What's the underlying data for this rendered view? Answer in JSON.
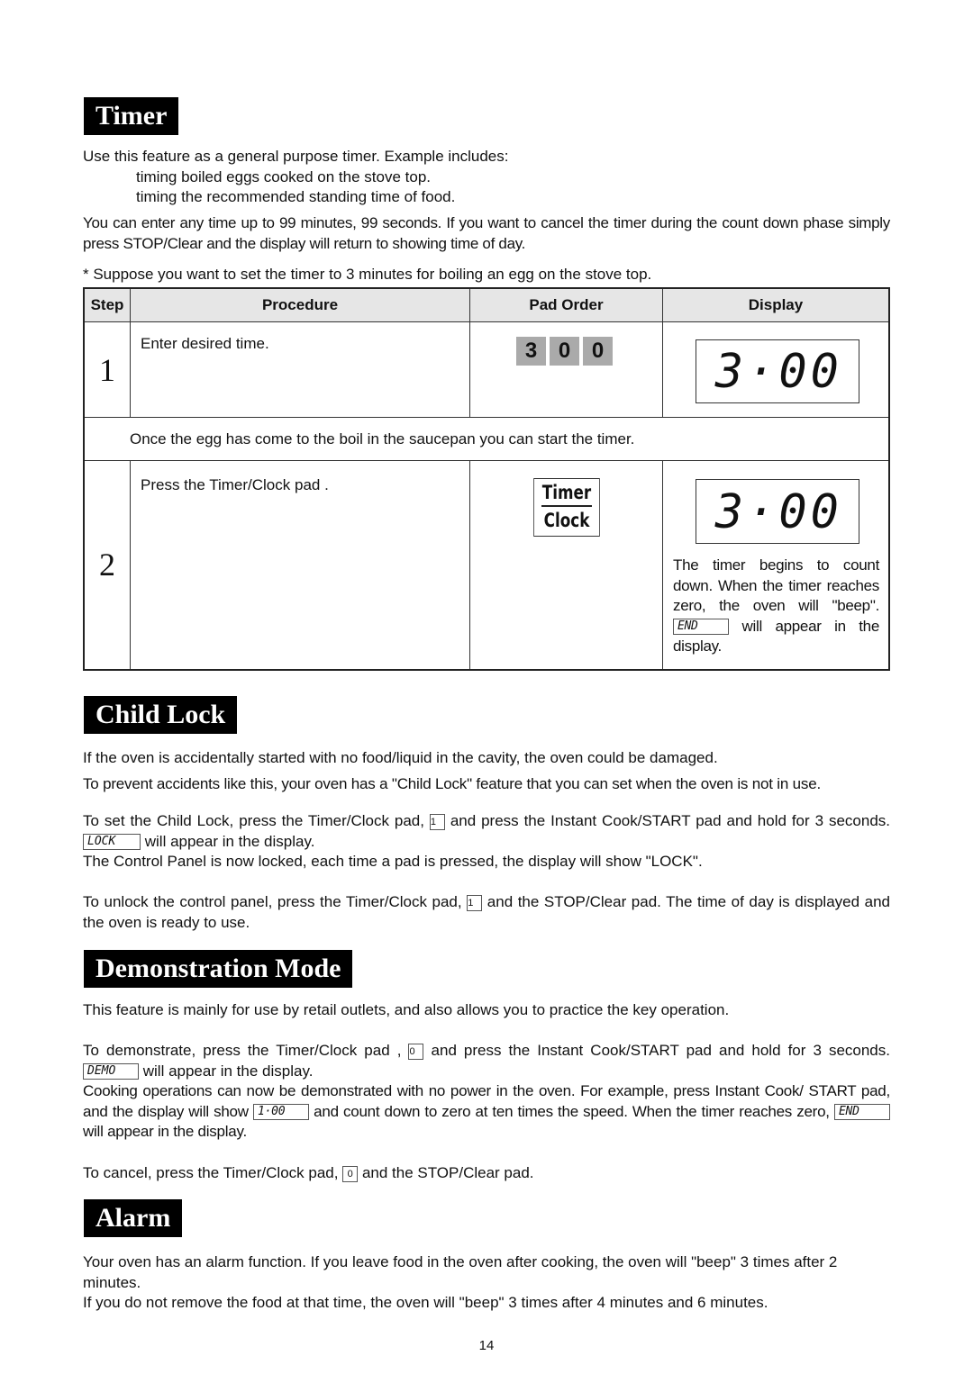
{
  "timer": {
    "heading": "Timer",
    "intro": "Use this feature as a general purpose timer. Example includes:",
    "examples": [
      "timing boiled eggs cooked on the stove top.",
      "timing the recommended standing time of food."
    ],
    "para2": "You can enter any time up to 99 minutes, 99 seconds. If you want to cancel the timer during the count down phase simply press STOP/Clear and the display will return to showing time of day.",
    "note": "* Suppose you want to set the timer to 3 minutes for boiling an egg on the stove top.",
    "table": {
      "headers": [
        "Step",
        "Procedure",
        "Pad Order",
        "Display"
      ],
      "step1": {
        "num": "1",
        "procedure": "Enter desired time.",
        "pads": [
          "3",
          "0",
          "0"
        ],
        "display": "3·00"
      },
      "between": "Once the egg has come to the boil in the saucepan you can start the timer.",
      "step2": {
        "num": "2",
        "procedure": "Press the Timer/Clock pad .",
        "pad_top": "Timer",
        "pad_bottom": "Clock",
        "display": "3·00",
        "desc_pre": "The timer begins to count down. When the timer reaches zero, the oven will \"beep\".",
        "end_label": "END",
        "desc_post": "will appear in the display."
      }
    }
  },
  "child_lock": {
    "heading": "Child Lock",
    "p1": "If the oven is accidentally started with no food/liquid in the cavity, the oven could be damaged.",
    "p2": "To prevent accidents like this, your oven has a \"Child Lock\" feature that you can set when the oven is not in use.",
    "p3a": "To set the Child Lock, press the Timer/Clock pad,",
    "key1": "1",
    "p3b": "and press the Instant Cook/START pad and hold for 3 seconds.",
    "lock_label": "LOCK",
    "p3c": "will appear in the display.",
    "p4": "The Control Panel is now locked, each time a pad is pressed, the display will show \"LOCK\".",
    "p5a": "To unlock the control panel, press the Timer/Clock pad,",
    "p5b": "and the STOP/Clear pad. The time of day is displayed and the oven is ready to use."
  },
  "demo": {
    "heading": "Demonstration Mode",
    "p1": "This feature is mainly for use by retail outlets, and also allows you to practice the key operation.",
    "p2a": "To demonstrate, press the Timer/Clock pad ,",
    "key0": "0",
    "p2b": "and press the Instant Cook/START pad and hold for 3 seconds.",
    "demo_label": "DEMO",
    "p2c": "will appear in the display.",
    "p3a": "Cooking operations can now be demonstrated with no power in the oven. For example, press Instant Cook/ START pad, and the display will show",
    "one_label": "1·00",
    "p3b": "and count down to zero at ten times the speed. When the timer reaches zero,",
    "end_label": "END",
    "p3c": "will appear in the display.",
    "p4a": "To cancel, press the Timer/Clock pad,",
    "p4b": "and the STOP/Clear pad."
  },
  "alarm": {
    "heading": "Alarm",
    "p1": "Your oven has an alarm function. If you leave food in the oven after cooking, the oven will \"beep\" 3 times after 2 minutes.",
    "p2": "If you do not remove the food at that time, the oven will \"beep\" 3 times after 4 minutes and 6 minutes."
  },
  "page_number": "14"
}
